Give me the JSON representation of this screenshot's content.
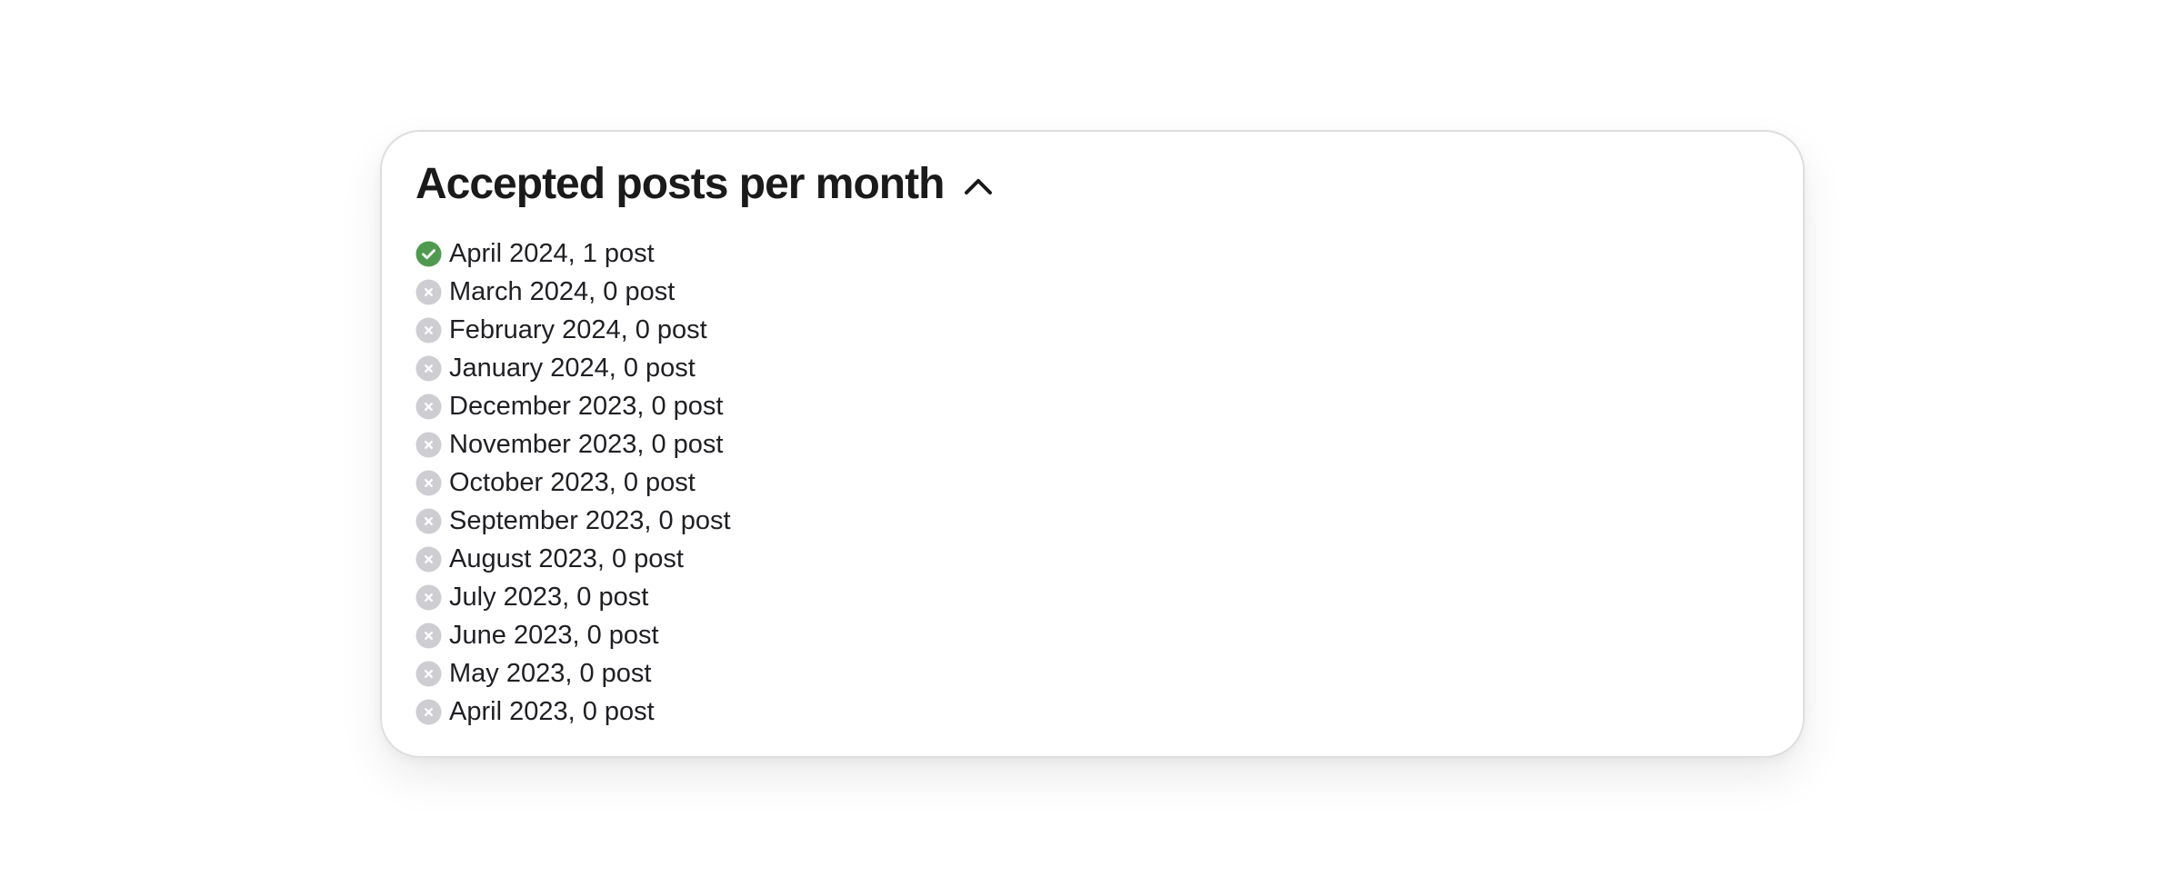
{
  "card": {
    "title": "Accepted posts per month",
    "toggle_icon": "chevron-up-icon",
    "months": [
      {
        "label": "April 2024, 1 post",
        "status": "accepted",
        "icon": "check-circle-icon"
      },
      {
        "label": "March 2024, 0 post",
        "status": "none",
        "icon": "x-circle-icon"
      },
      {
        "label": "February 2024, 0 post",
        "status": "none",
        "icon": "x-circle-icon"
      },
      {
        "label": "January 2024, 0 post",
        "status": "none",
        "icon": "x-circle-icon"
      },
      {
        "label": "December 2023, 0 post",
        "status": "none",
        "icon": "x-circle-icon"
      },
      {
        "label": "November 2023, 0 post",
        "status": "none",
        "icon": "x-circle-icon"
      },
      {
        "label": "October 2023, 0 post",
        "status": "none",
        "icon": "x-circle-icon"
      },
      {
        "label": "September 2023, 0 post",
        "status": "none",
        "icon": "x-circle-icon"
      },
      {
        "label": "August 2023, 0 post",
        "status": "none",
        "icon": "x-circle-icon"
      },
      {
        "label": "July 2023, 0 post",
        "status": "none",
        "icon": "x-circle-icon"
      },
      {
        "label": "June 2023, 0 post",
        "status": "none",
        "icon": "x-circle-icon"
      },
      {
        "label": "May 2023, 0 post",
        "status": "none",
        "icon": "x-circle-icon"
      },
      {
        "label": "April 2023, 0 post",
        "status": "none",
        "icon": "x-circle-icon"
      }
    ]
  },
  "colors": {
    "accepted": "#4f9a4f",
    "none": "#cdcdd2",
    "text": "#1f1f24",
    "title": "#1a1a1a"
  }
}
